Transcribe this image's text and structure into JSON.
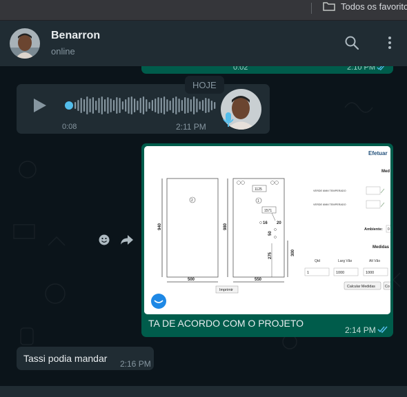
{
  "browser": {
    "bookmark_folder": "Todos os favoritos"
  },
  "header": {
    "contact_name": "Benarron",
    "status": "online",
    "search_icon": "search-icon",
    "menu_icon": "kebab-menu-icon"
  },
  "chat": {
    "previous_message": {
      "duration": "0:02",
      "time": "2:10 PM"
    },
    "day_separator": "HOJE",
    "audio_message": {
      "duration": "0:08",
      "time": "2:11 PM"
    },
    "image_message": {
      "caption": "TA DE ACORDO COM O PROJETO",
      "time": "2:14 PM",
      "drawing": {
        "header_text": "Efetuar",
        "section_headers": [
          "Med",
          "Medidas"
        ],
        "glass_types": [
          "VERDE 6MM TEMPERADO",
          "VERDE 6MM TEMPERADO"
        ],
        "ambiente_label": "Ambiente:",
        "ambiente_value": "0",
        "panel_left": {
          "height": "940",
          "width": "500",
          "marker": "2"
        },
        "panel_right": {
          "height": "980",
          "width": "550",
          "marker": "1",
          "box_top": "1125",
          "box_mid": "1571",
          "dims": [
            "16",
            "20",
            "50",
            "275",
            "300"
          ]
        },
        "field_labels": [
          "Qtd",
          "Larg Vão",
          "Alt Vão"
        ],
        "field_values": [
          "1",
          "1000",
          "1000"
        ],
        "calc_button": "Calcular Medidas",
        "extra_button": "Co",
        "print_button": "Imprimir"
      }
    },
    "text_message": {
      "text": "Tassi podia mandar",
      "time": "2:16 PM"
    }
  },
  "colors": {
    "outgoing": "#005c4b",
    "incoming": "#202c33",
    "accent": "#53bdeb",
    "background": "#0b141a"
  }
}
